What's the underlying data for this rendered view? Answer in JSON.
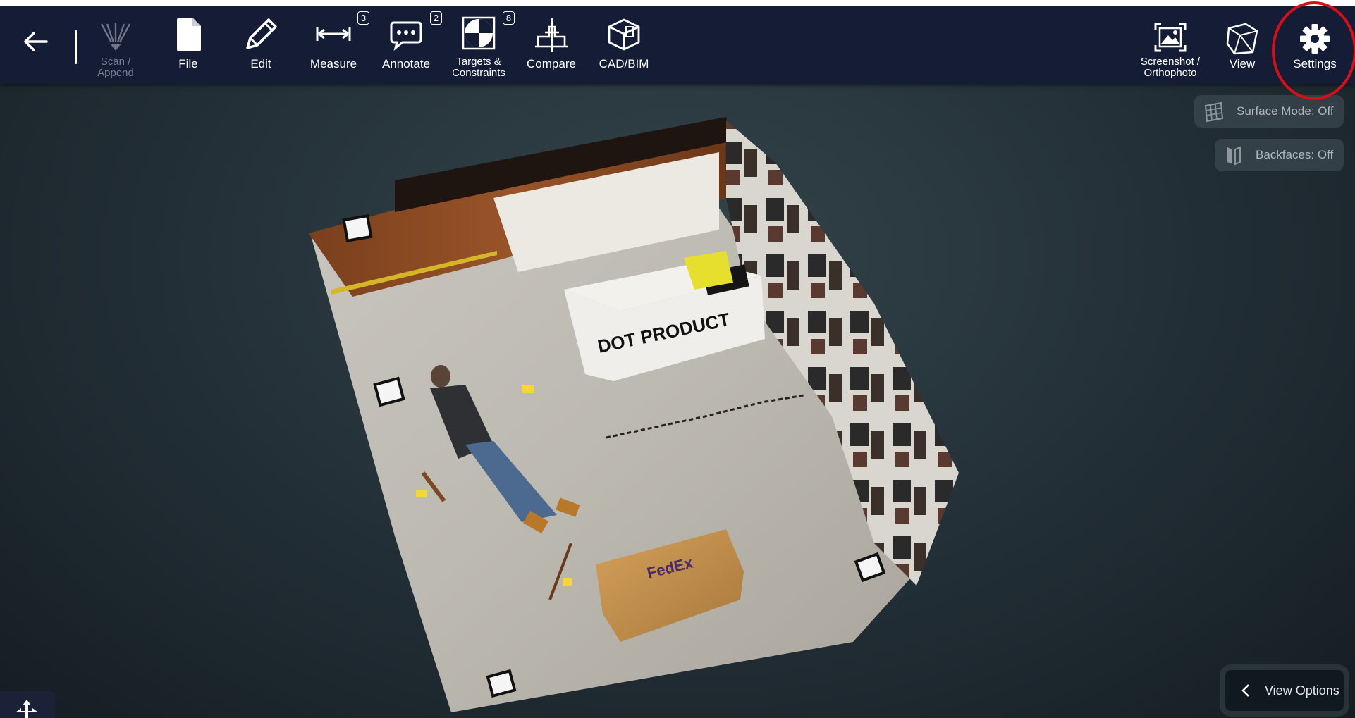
{
  "toolbar": {
    "back": {
      "icon": "arrow-left-icon"
    },
    "items": [
      {
        "id": "scan",
        "label_line1": "Scan /",
        "label_line2": "Append",
        "icon": "scanner-icon",
        "disabled": true
      },
      {
        "id": "file",
        "label": "File",
        "icon": "file-icon"
      },
      {
        "id": "edit",
        "label": "Edit",
        "icon": "pencil-icon"
      },
      {
        "id": "measure",
        "label": "Measure",
        "icon": "ruler-icon",
        "badge": "3"
      },
      {
        "id": "annotate",
        "label": "Annotate",
        "icon": "speech-bubble-icon",
        "badge": "2"
      },
      {
        "id": "targets",
        "label_line1": "Targets &",
        "label_line2": "Constraints",
        "icon": "target-icon",
        "badge": "8"
      },
      {
        "id": "compare",
        "label": "Compare",
        "icon": "compare-icon"
      },
      {
        "id": "cadbim",
        "label": "CAD/BIM",
        "icon": "cube-model-icon"
      }
    ],
    "right_items": [
      {
        "id": "screenshot",
        "label_line1": "Screenshot /",
        "label_line2": "Orthophoto",
        "icon": "screenshot-icon"
      },
      {
        "id": "view",
        "label": "View",
        "icon": "view-cube-icon"
      },
      {
        "id": "settings",
        "label": "Settings",
        "icon": "gear-icon"
      }
    ]
  },
  "overlays": {
    "surface_mode": "Surface Mode: Off",
    "backfaces": "Backfaces: Off",
    "view_options": "View Options"
  },
  "scene": {
    "logo_line1": "DOT",
    "logo_line2": "PRODUCT",
    "box_text": "FedEx",
    "banner_text": "DOT PRODUCT"
  },
  "colors": {
    "toolbar_bg": "#151c35",
    "highlight": "#d40f1a",
    "accent": "#ffffff"
  }
}
